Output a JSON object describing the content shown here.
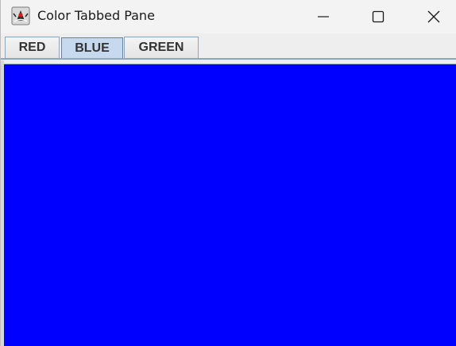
{
  "window": {
    "title": "Color Tabbed Pane",
    "app_icon": "java-duke-icon"
  },
  "titlebar_controls": {
    "minimize_icon": "minimize-icon",
    "maximize_icon": "maximize-icon",
    "close_icon": "close-icon"
  },
  "tabs": [
    {
      "label": "RED",
      "selected": false
    },
    {
      "label": "BLUE",
      "selected": true
    },
    {
      "label": "GREEN",
      "selected": false
    }
  ],
  "content": {
    "panel_color": "#0000ff"
  },
  "colors": {
    "tab_selected_bg": "#c6d9ef",
    "tab_border": "#8da5bf"
  }
}
